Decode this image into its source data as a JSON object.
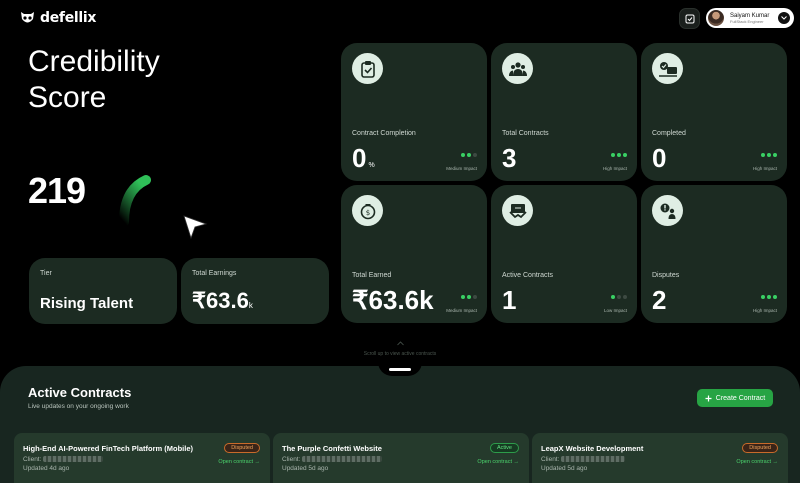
{
  "header": {
    "brand": "defellix",
    "user_name": "Saiyam Kumar",
    "user_role": "FullStack Engineer"
  },
  "hero": {
    "title_line1": "Credibility",
    "title_line2": "Score",
    "score": "219"
  },
  "summary": {
    "tier_label": "Tier",
    "tier_value": "Rising Talent",
    "earnings_label": "Total Earnings",
    "earnings_value": "₹63.6",
    "earnings_unit": "k"
  },
  "stats": [
    {
      "label": "Contract Completion",
      "value": "0",
      "unit": "%",
      "impact": "Medium Impact",
      "impact_level": 2,
      "icon": "clipboard-check-icon"
    },
    {
      "label": "Total Contracts",
      "value": "3",
      "unit": "",
      "impact": "High Impact",
      "impact_level": 3,
      "icon": "people-group-icon"
    },
    {
      "label": "Completed",
      "value": "0",
      "unit": "",
      "impact": "High Impact",
      "impact_level": 3,
      "icon": "task-done-icon"
    },
    {
      "label": "Total Earned",
      "value": "₹63.6k",
      "unit": "",
      "impact": "Medium Impact",
      "impact_level": 2,
      "icon": "money-bag-icon"
    },
    {
      "label": "Active Contracts",
      "value": "1",
      "unit": "",
      "impact": "Low Impact",
      "impact_level": 1,
      "icon": "handshake-icon"
    },
    {
      "label": "Disputes",
      "value": "2",
      "unit": "",
      "impact": "High Impact",
      "impact_level": 3,
      "icon": "dispute-alert-icon"
    }
  ],
  "scroll_hint": "Scroll up to view active contracts",
  "active_contracts": {
    "title": "Active Contracts",
    "subtitle": "Live updates on your ongoing work",
    "create_label": "Create Contract",
    "items": [
      {
        "name": "High-End AI-Powered FinTech Platform (Mobile)",
        "client": "Client:",
        "updated": "Updated 4d ago",
        "status": "Disputed",
        "open": "Open contract →",
        "bar_color": "#c0552a"
      },
      {
        "name": "The Purple Confetti Website",
        "client": "Client:",
        "updated": "Updated 5d ago",
        "status": "Active",
        "open": "Open contract →",
        "bar_color": "#39d064"
      },
      {
        "name": "LeapX Website Development",
        "client": "Client:",
        "updated": "Updated 5d ago",
        "status": "Disputed",
        "open": "Open contract →",
        "bar_color": "#c0552a"
      }
    ]
  },
  "colors": {
    "accent": "#39d064",
    "card": "#1c2b22",
    "panel": "#182620"
  }
}
